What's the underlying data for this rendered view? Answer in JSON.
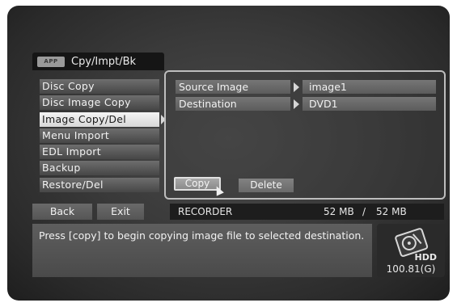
{
  "header": {
    "badge": "APP",
    "title": "Cpy/Impt/Bk"
  },
  "menu": {
    "items": [
      {
        "label": "Disc Copy"
      },
      {
        "label": "Disc Image Copy"
      },
      {
        "label": "Image Copy/Del"
      },
      {
        "label": "Menu Import"
      },
      {
        "label": "EDL Import"
      },
      {
        "label": "Backup"
      },
      {
        "label": "Restore/Del"
      }
    ],
    "selected": "Image Copy/Del"
  },
  "panel": {
    "rows": [
      {
        "label": "Source Image",
        "value": "image1"
      },
      {
        "label": "Destination",
        "value": "DVD1"
      }
    ],
    "copy_label": "Copy",
    "delete_label": "Delete"
  },
  "footer": {
    "back_label": "Back",
    "exit_label": "Exit",
    "status": {
      "device": "RECORDER",
      "used": "52 MB",
      "separator": "/",
      "total": "52 MB"
    },
    "message": "Press [copy] to begin copying image file to selected destination.",
    "hdd": {
      "label": "HDD",
      "capacity": "100.81(G)"
    }
  }
}
